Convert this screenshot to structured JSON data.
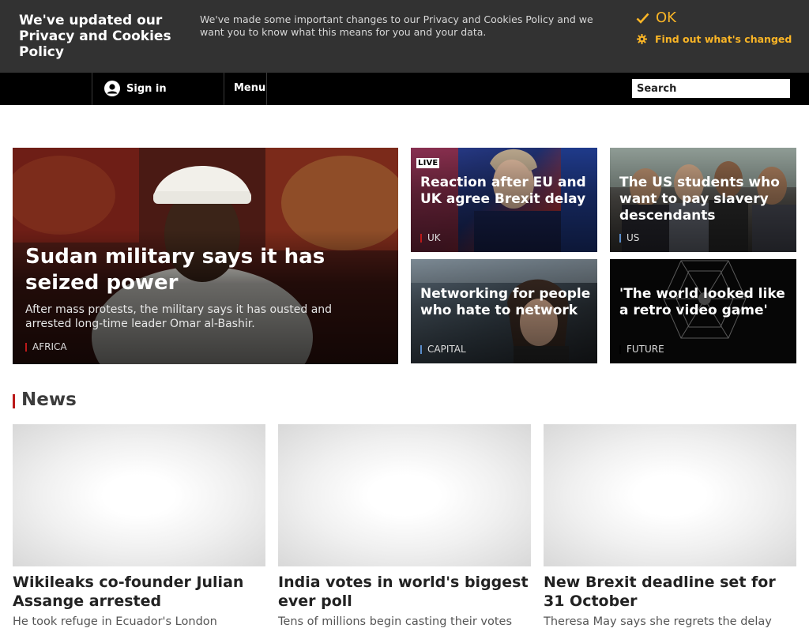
{
  "cookie_banner": {
    "title": "We've updated our Privacy and Cookies Policy",
    "message": "We've made some important changes to our Privacy and Cookies Policy and we want you to know what this means for you and your data.",
    "ok_label": "OK",
    "find_out_label": "Find out what's changed",
    "accent_color": "#fab526"
  },
  "nav": {
    "signin_label": "Sign in",
    "menu_label": "Menu",
    "search_placeholder": "Search"
  },
  "hero": {
    "title": "Sudan military says it has seized power",
    "summary": "After mass protests, the military says it has ousted and arrested long-time leader Omar al-Bashir.",
    "tag": "AFRICA",
    "tag_color": "#bb1919"
  },
  "top_stories": [
    {
      "badge": "LIVE",
      "title": "Reaction after EU and UK agree Brexit delay",
      "tag": "UK",
      "tag_color": "#bb1919"
    },
    {
      "title": "The US students who want to pay slavery descendants",
      "tag": "US",
      "tag_color": "#5a8dcc"
    },
    {
      "title": "Networking for people who hate to network",
      "tag": "CAPITAL",
      "tag_color": "#5a8dcc"
    },
    {
      "title": "'The world looked like a retro video game'",
      "tag": "FUTURE",
      "tag_color": "#000000"
    }
  ],
  "news_section": {
    "heading": "News",
    "accent_color": "#bb1919",
    "items": [
      {
        "title": "Wikileaks co-founder Julian Assange arrested",
        "summary": "He took refuge in Ecuador's London"
      },
      {
        "title": "India votes in world's biggest ever poll",
        "summary": "Tens of millions begin casting their votes"
      },
      {
        "title": "New Brexit deadline set for 31 October",
        "summary": "Theresa May says she regrets the delay"
      }
    ]
  }
}
